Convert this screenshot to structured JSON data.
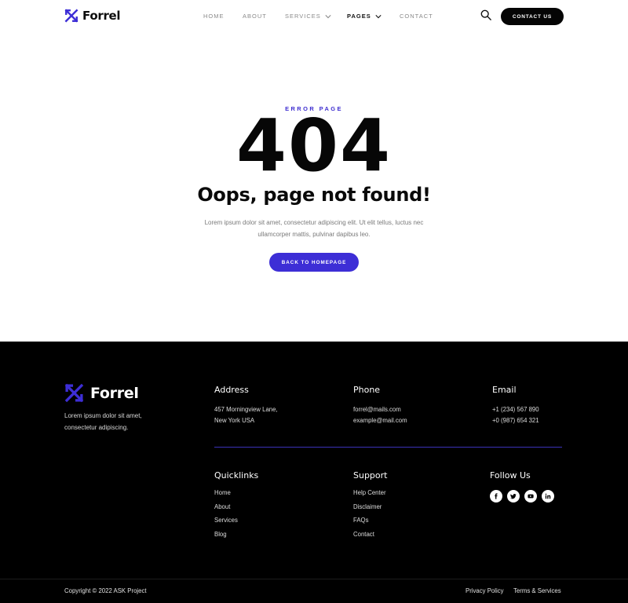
{
  "brand": {
    "name": "Forrel",
    "accent": "#3d2ed6"
  },
  "nav": {
    "items": [
      {
        "label": "HOME"
      },
      {
        "label": "ABOUT"
      },
      {
        "label": "SERVICES"
      },
      {
        "label": "PAGES"
      },
      {
        "label": "CONTACT"
      }
    ],
    "active": "PAGES",
    "contact_button": "CONTACT US",
    "search_icon": "search-icon"
  },
  "hero": {
    "eyebrow": "ERROR PAGE",
    "code": "404",
    "title": "Oops, page not found!",
    "description": "Lorem ipsum dolor sit amet, consectetur adipiscing elit. Ut elit tellus, luctus nec ullamcorper mattis, pulvinar dapibus leo.",
    "button": "BACK TO HOMEPAGE"
  },
  "footer": {
    "brand": "Forrel",
    "tagline": "Lorem ipsum dolor sit amet, consectetur adipiscing.",
    "address": {
      "heading": "Address",
      "line1": "457 Morningview Lane,",
      "line2": "New York USA"
    },
    "phone": {
      "heading": "Phone",
      "line1": "forrel@mails.com",
      "line2": "example@mail.com"
    },
    "email": {
      "heading": "Email",
      "line1": "+1 (234) 567 890",
      "line2": "+0 (987) 654 321"
    },
    "quicklinks": {
      "heading": "Quicklinks",
      "links": [
        "Home",
        "About",
        "Services",
        "Blog"
      ]
    },
    "support": {
      "heading": "Support",
      "links": [
        "Help Center",
        "Disclaimer",
        "FAQs",
        "Contact"
      ]
    },
    "follow": {
      "heading": "Follow Us",
      "icons": [
        "facebook-icon",
        "twitter-icon",
        "youtube-icon",
        "linkedin-icon"
      ]
    },
    "copyright": "Copyright © 2022 ASK Project",
    "legal": [
      "Privacy Policy",
      "Terms & Services"
    ]
  }
}
